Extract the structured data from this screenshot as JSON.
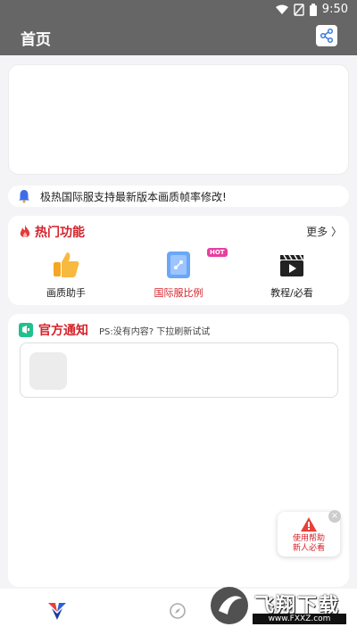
{
  "status": {
    "time": "9:50"
  },
  "appbar": {
    "title": "首页"
  },
  "notice": {
    "text": "极热国际服支持最新版本画质帧率修改!"
  },
  "hot": {
    "title": "热门功能",
    "more": "更多",
    "items": [
      {
        "label": "画质助手",
        "color": "#222222"
      },
      {
        "label": "国际服比例",
        "color": "#d4232b"
      },
      {
        "label": "教程/必看",
        "color": "#222222"
      }
    ],
    "badge": "HOT"
  },
  "official": {
    "title": "官方通知",
    "hint": "PS:没有内容? 下拉刷新试试"
  },
  "help": {
    "line1": "使用帮助",
    "line2": "新人必看"
  },
  "watermark": {
    "brand": "飞翔下载",
    "url": "www.FXXZ.com"
  },
  "colors": {
    "accent": "#d4232b",
    "header": "#666666"
  }
}
